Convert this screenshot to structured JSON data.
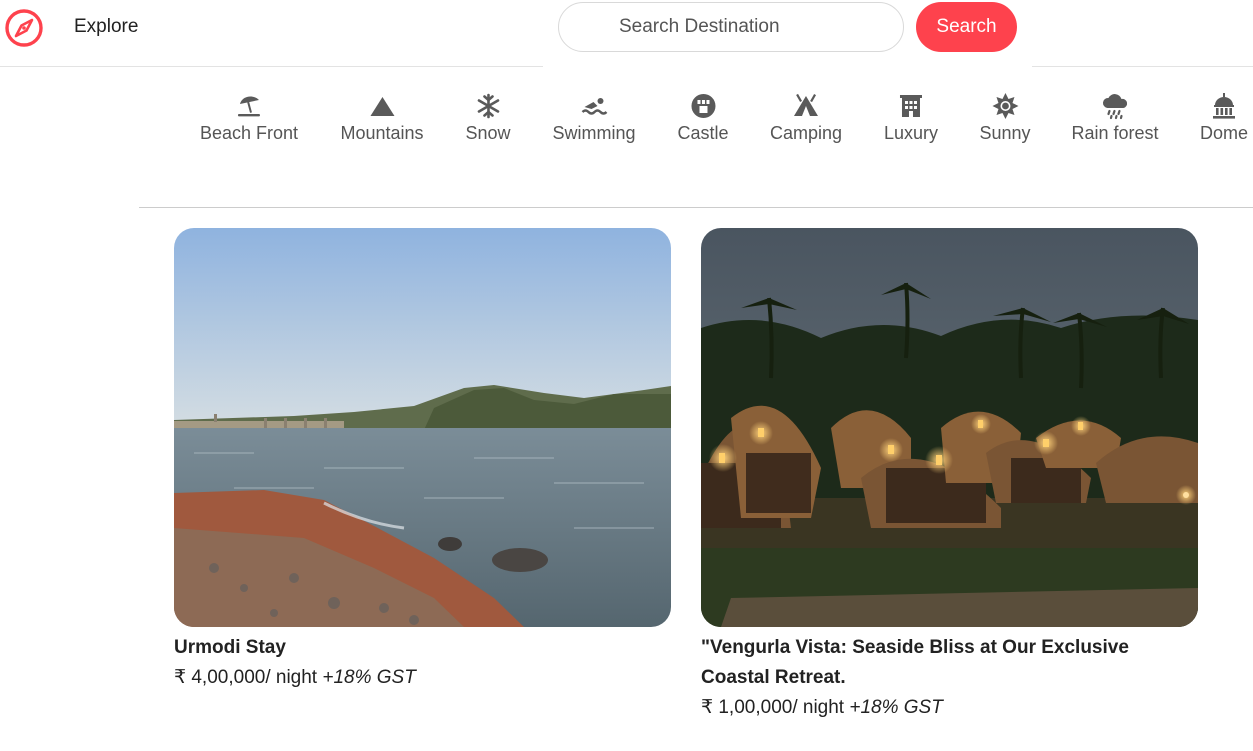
{
  "navbar": {
    "logo_icon": "compass-icon",
    "brand_color": "#fe424d",
    "explore_label": "Explore",
    "search_placeholder": "Search Destination",
    "search_button_label": "Search"
  },
  "filters": [
    {
      "label": "Beach Front",
      "icon": "umbrella-beach-icon"
    },
    {
      "label": "Mountains",
      "icon": "mountain-icon"
    },
    {
      "label": "Snow",
      "icon": "snowflake-icon"
    },
    {
      "label": "Swimming",
      "icon": "person-swimming-icon"
    },
    {
      "label": "Castle",
      "icon": "chess-rook-icon"
    },
    {
      "label": "Camping",
      "icon": "tent-icon"
    },
    {
      "label": "Luxury",
      "icon": "hotel-icon"
    },
    {
      "label": "Sunny",
      "icon": "sun-icon"
    },
    {
      "label": "Rain forest",
      "icon": "cloud-rain-icon"
    },
    {
      "label": "Dome",
      "icon": "landmark-dome-icon"
    }
  ],
  "listings": [
    {
      "title": "Urmodi Stay",
      "price": "₹ 4,00,000/ night ",
      "tax": "+18% GST",
      "image": "lake-shore-with-hills-photo"
    },
    {
      "title": "\"Vengurla Vista: Seaside Bliss at Our Exclusive Coastal Retreat.",
      "price": "₹ 1,00,000/ night ",
      "tax": "+18% GST",
      "image": "thatched-huts-under-palm-trees-at-dusk-photo"
    }
  ]
}
